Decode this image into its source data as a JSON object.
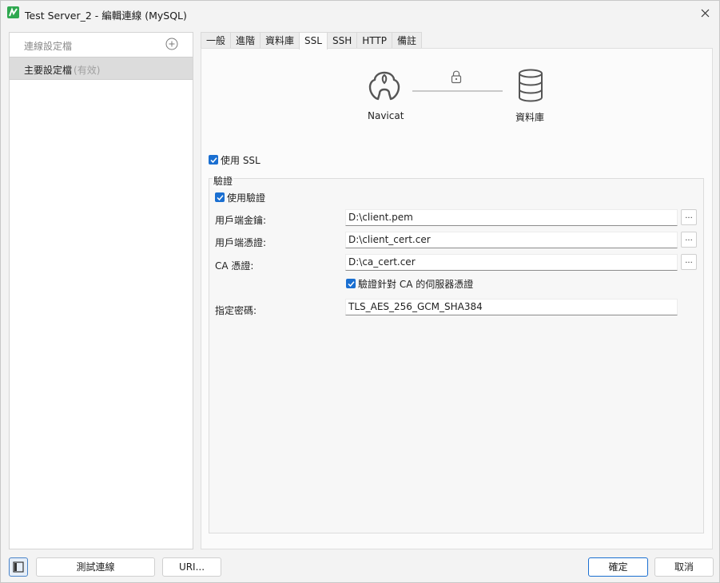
{
  "window": {
    "title": "Test Server_2 - 編輯連線 (MySQL)"
  },
  "sidebar": {
    "header_label": "連線設定檔",
    "items": [
      {
        "label": "主要設定檔",
        "status": "(有效)"
      }
    ]
  },
  "tabs": [
    {
      "label": "一般"
    },
    {
      "label": "進階"
    },
    {
      "label": "資料庫"
    },
    {
      "label": "SSL",
      "active": true
    },
    {
      "label": "SSH"
    },
    {
      "label": "HTTP"
    },
    {
      "label": "備註"
    }
  ],
  "diagram": {
    "client_label": "Navicat",
    "server_label": "資料庫"
  },
  "ssl": {
    "use_ssl_label": "使用 SSL",
    "use_ssl_checked": true,
    "group_title": "驗證",
    "use_auth_label": "使用驗證",
    "use_auth_checked": true,
    "client_key_label": "用戶端金鑰:",
    "client_key_value": "D:\\client.pem",
    "client_cert_label": "用戶端憑證:",
    "client_cert_value": "D:\\client_cert.cer",
    "ca_cert_label": "CA 憑證:",
    "ca_cert_value": "D:\\ca_cert.cer",
    "verify_ca_label": "驗證針對 CA 的伺服器憑證",
    "verify_ca_checked": true,
    "cipher_label": "指定密碼:",
    "cipher_value": "TLS_AES_256_GCM_SHA384",
    "browse_label": "..."
  },
  "footer": {
    "test_button": "測試連線",
    "uri_button": "URI...",
    "ok_button": "確定",
    "cancel_button": "取消"
  },
  "colors": {
    "accent": "#1a6fd1",
    "brand_green": "#2fa84f"
  }
}
